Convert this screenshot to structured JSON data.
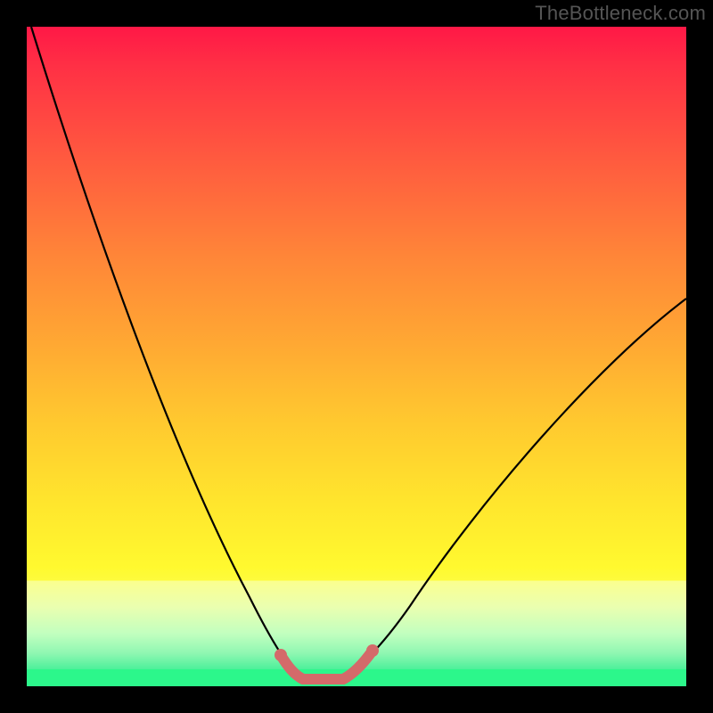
{
  "watermark": "TheBottleneck.com",
  "colors": {
    "bg": "#000000",
    "gradient_top": "#ff1846",
    "gradient_mid": "#ffe52d",
    "gradient_bottom": "#2cf78b",
    "curve": "#000000",
    "highlight": "#d46a6a"
  },
  "chart_data": {
    "type": "line",
    "title": "",
    "xlabel": "",
    "ylabel": "",
    "xlim": [
      0,
      100
    ],
    "ylim": [
      0,
      100
    ],
    "series": [
      {
        "name": "bottleneck-curve",
        "x": [
          0,
          5,
          10,
          15,
          20,
          25,
          30,
          35,
          38,
          40,
          42,
          44,
          46,
          48,
          50,
          55,
          60,
          65,
          70,
          75,
          80,
          85,
          90,
          95,
          100
        ],
        "y": [
          100,
          89,
          78,
          67,
          56,
          45,
          34,
          22,
          12,
          6,
          2,
          0,
          0,
          0,
          2,
          9,
          17,
          25,
          32,
          39,
          45,
          50,
          55,
          59,
          62
        ]
      }
    ],
    "annotations": [
      {
        "name": "optimal-zone",
        "x_range": [
          40,
          50
        ],
        "y": 0,
        "color": "#d46a6a"
      }
    ]
  }
}
